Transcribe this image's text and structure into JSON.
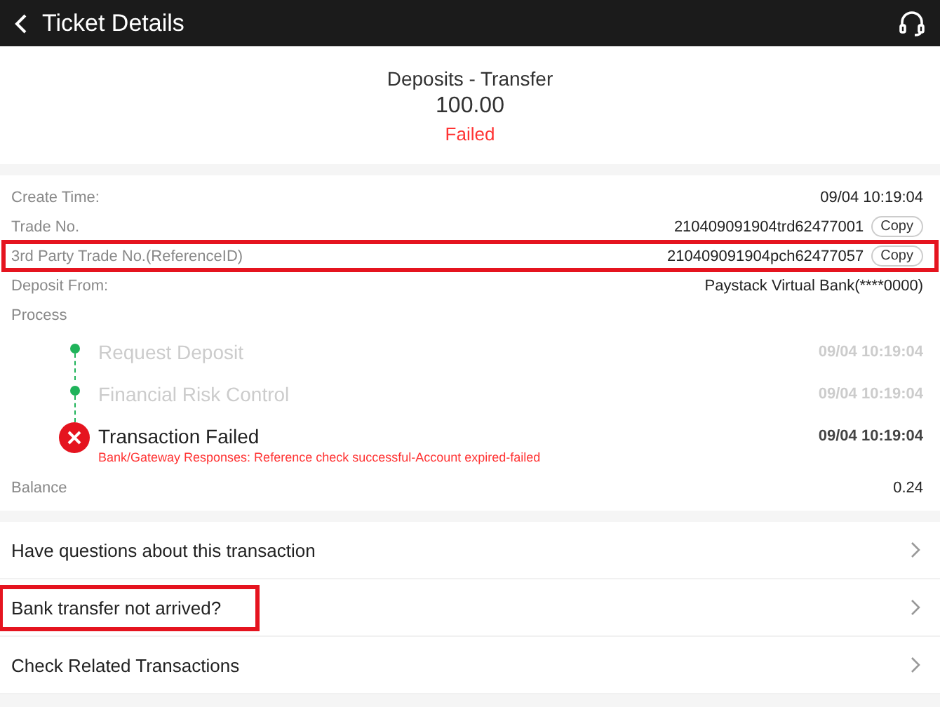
{
  "header": {
    "title": "Ticket Details"
  },
  "summary": {
    "type": "Deposits - Transfer",
    "amount": "100.00",
    "status": "Failed"
  },
  "details": [
    {
      "label": "Create Time:",
      "value": "09/04 10:19:04",
      "highlighted": false
    },
    {
      "label": "Trade No.",
      "value": "210409091904trd62477001",
      "copy": "Copy",
      "highlighted": false
    },
    {
      "label": "3rd Party Trade No.(ReferenceID)",
      "value": "210409091904pch62477057",
      "copy": "Copy",
      "highlighted": true
    },
    {
      "label": "Deposit From:",
      "value": "Paystack Virtual Bank(****0000)",
      "highlighted": false
    }
  ],
  "process": {
    "label": "Process",
    "steps": [
      {
        "kind": "done",
        "title": "Request Deposit",
        "time": "09/04 10:19:04"
      },
      {
        "kind": "done",
        "title": "Financial Risk Control",
        "time": "09/04 10:19:04"
      },
      {
        "kind": "failed",
        "title": "Transaction Failed",
        "time": "09/04 10:19:04",
        "note": "Bank/Gateway Responses: Reference check successful-Account expired-failed"
      }
    ]
  },
  "balance": {
    "label": "Balance",
    "value": "0.24"
  },
  "links": [
    {
      "label": "Have questions about this transaction",
      "highlighted": false
    },
    {
      "label": "Bank transfer not arrived?",
      "highlighted": true
    },
    {
      "label": "Check Related Transactions",
      "highlighted": false
    }
  ]
}
